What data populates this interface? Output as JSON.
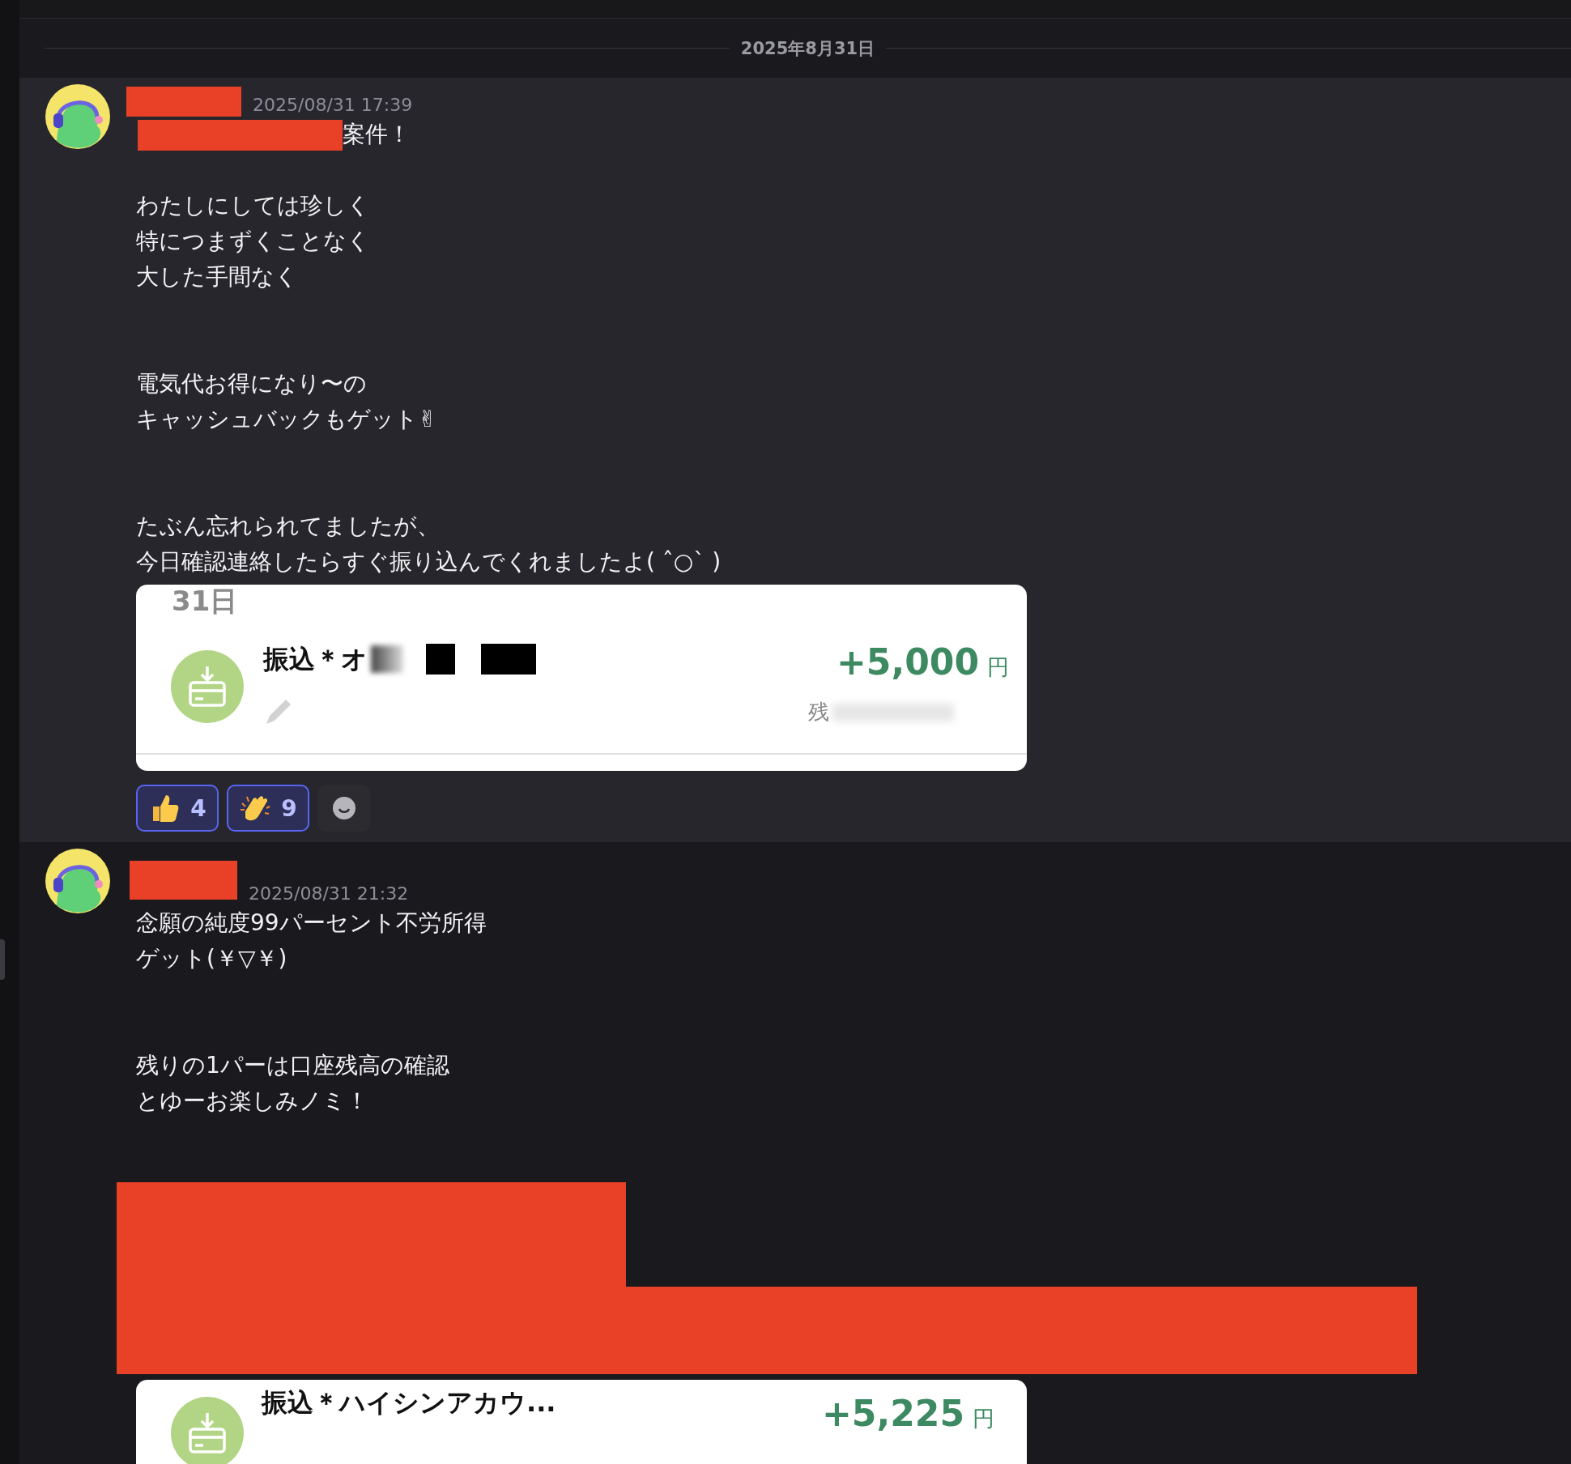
{
  "date_divider": "2025年8月31日",
  "messages": [
    {
      "highlighted": true,
      "timestamp": "2025/08/31 17:39",
      "paragraphs": [
        [
          "案件！"
        ],
        [
          "わたしにしては珍しく",
          "特につまずくことなく",
          "大した手間なく"
        ],
        [
          "電気代お得になり〜の",
          "キャッシュバックもゲット✌"
        ],
        [
          "たぶん忘れられてましたが、",
          "今日確認連絡したらすぐ振り込んでくれましたよ( ˆ○ˋ )"
        ]
      ],
      "attachment": {
        "date": "31日",
        "title": "振込＊オ",
        "amount": "+5,000",
        "currency": "円",
        "balance_label": "残"
      },
      "reactions": [
        {
          "kind": "thumbs_up",
          "count": "4",
          "selected": true
        },
        {
          "kind": "clap",
          "count": "9",
          "selected": true
        }
      ]
    },
    {
      "timestamp": "2025/08/31 21:32",
      "paragraphs": [
        [
          "念願の純度99パーセント不労所得",
          "ゲット(￥▽￥)"
        ],
        [
          "残りの1パーは口座残高の確認",
          "とゆーお楽しみノミ！"
        ]
      ],
      "attachment": {
        "title": "振込＊ハイシンアカウ...",
        "amount": "+5,225",
        "currency": "円"
      }
    }
  ]
}
